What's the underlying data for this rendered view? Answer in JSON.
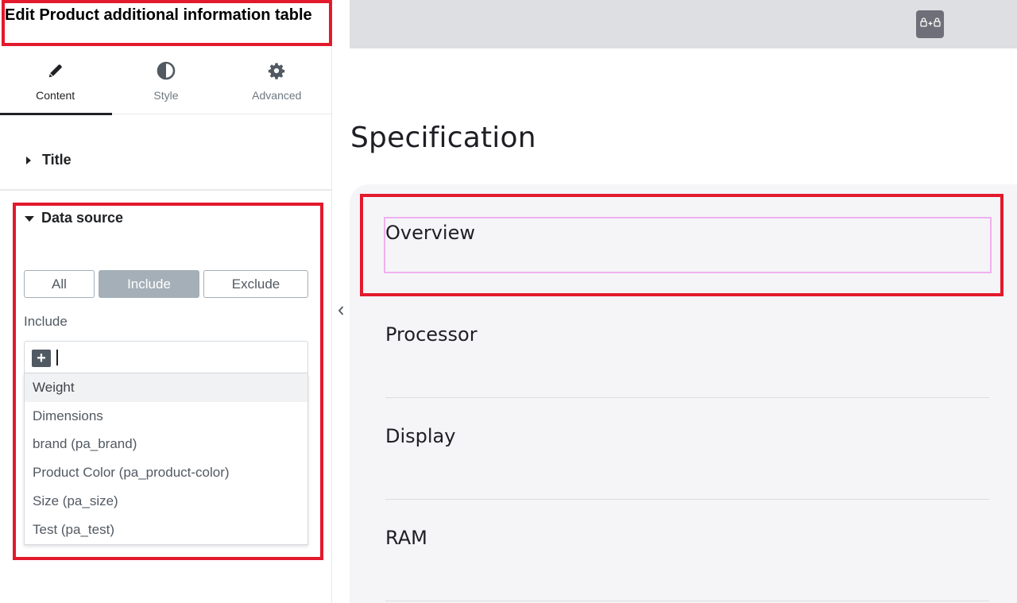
{
  "panel": {
    "title": "Edit Product additional information table",
    "tabs": [
      {
        "label": "Content",
        "icon": "pencil-icon",
        "active": true
      },
      {
        "label": "Style",
        "icon": "half-circle-icon",
        "active": false
      },
      {
        "label": "Advanced",
        "icon": "gear-icon",
        "active": false
      }
    ],
    "sections": {
      "title_label": "Title",
      "data_source_label": "Data source"
    },
    "source_mode": {
      "options": [
        "All",
        "Include",
        "Exclude"
      ],
      "selected": "Include"
    },
    "include": {
      "label": "Include",
      "input_value": "",
      "add_icon": "plus-icon"
    },
    "dropdown_options": [
      "Weight",
      "Dimensions",
      "brand (pa_brand)",
      "Product Color (pa_product-color)",
      "Size (pa_size)",
      "Test (pa_test)"
    ],
    "hovered_option": "Weight"
  },
  "preview": {
    "toolbar_icon": "lock-plus-lock-icon",
    "heading": "Specification",
    "items": [
      "Overview",
      "Processor",
      "Display",
      "RAM"
    ]
  },
  "colors": {
    "highlight": "#e3192c",
    "selection_outline": "#f0b0f0",
    "active_segment": "#a4afb7",
    "card_background": "#f5f5f8"
  }
}
